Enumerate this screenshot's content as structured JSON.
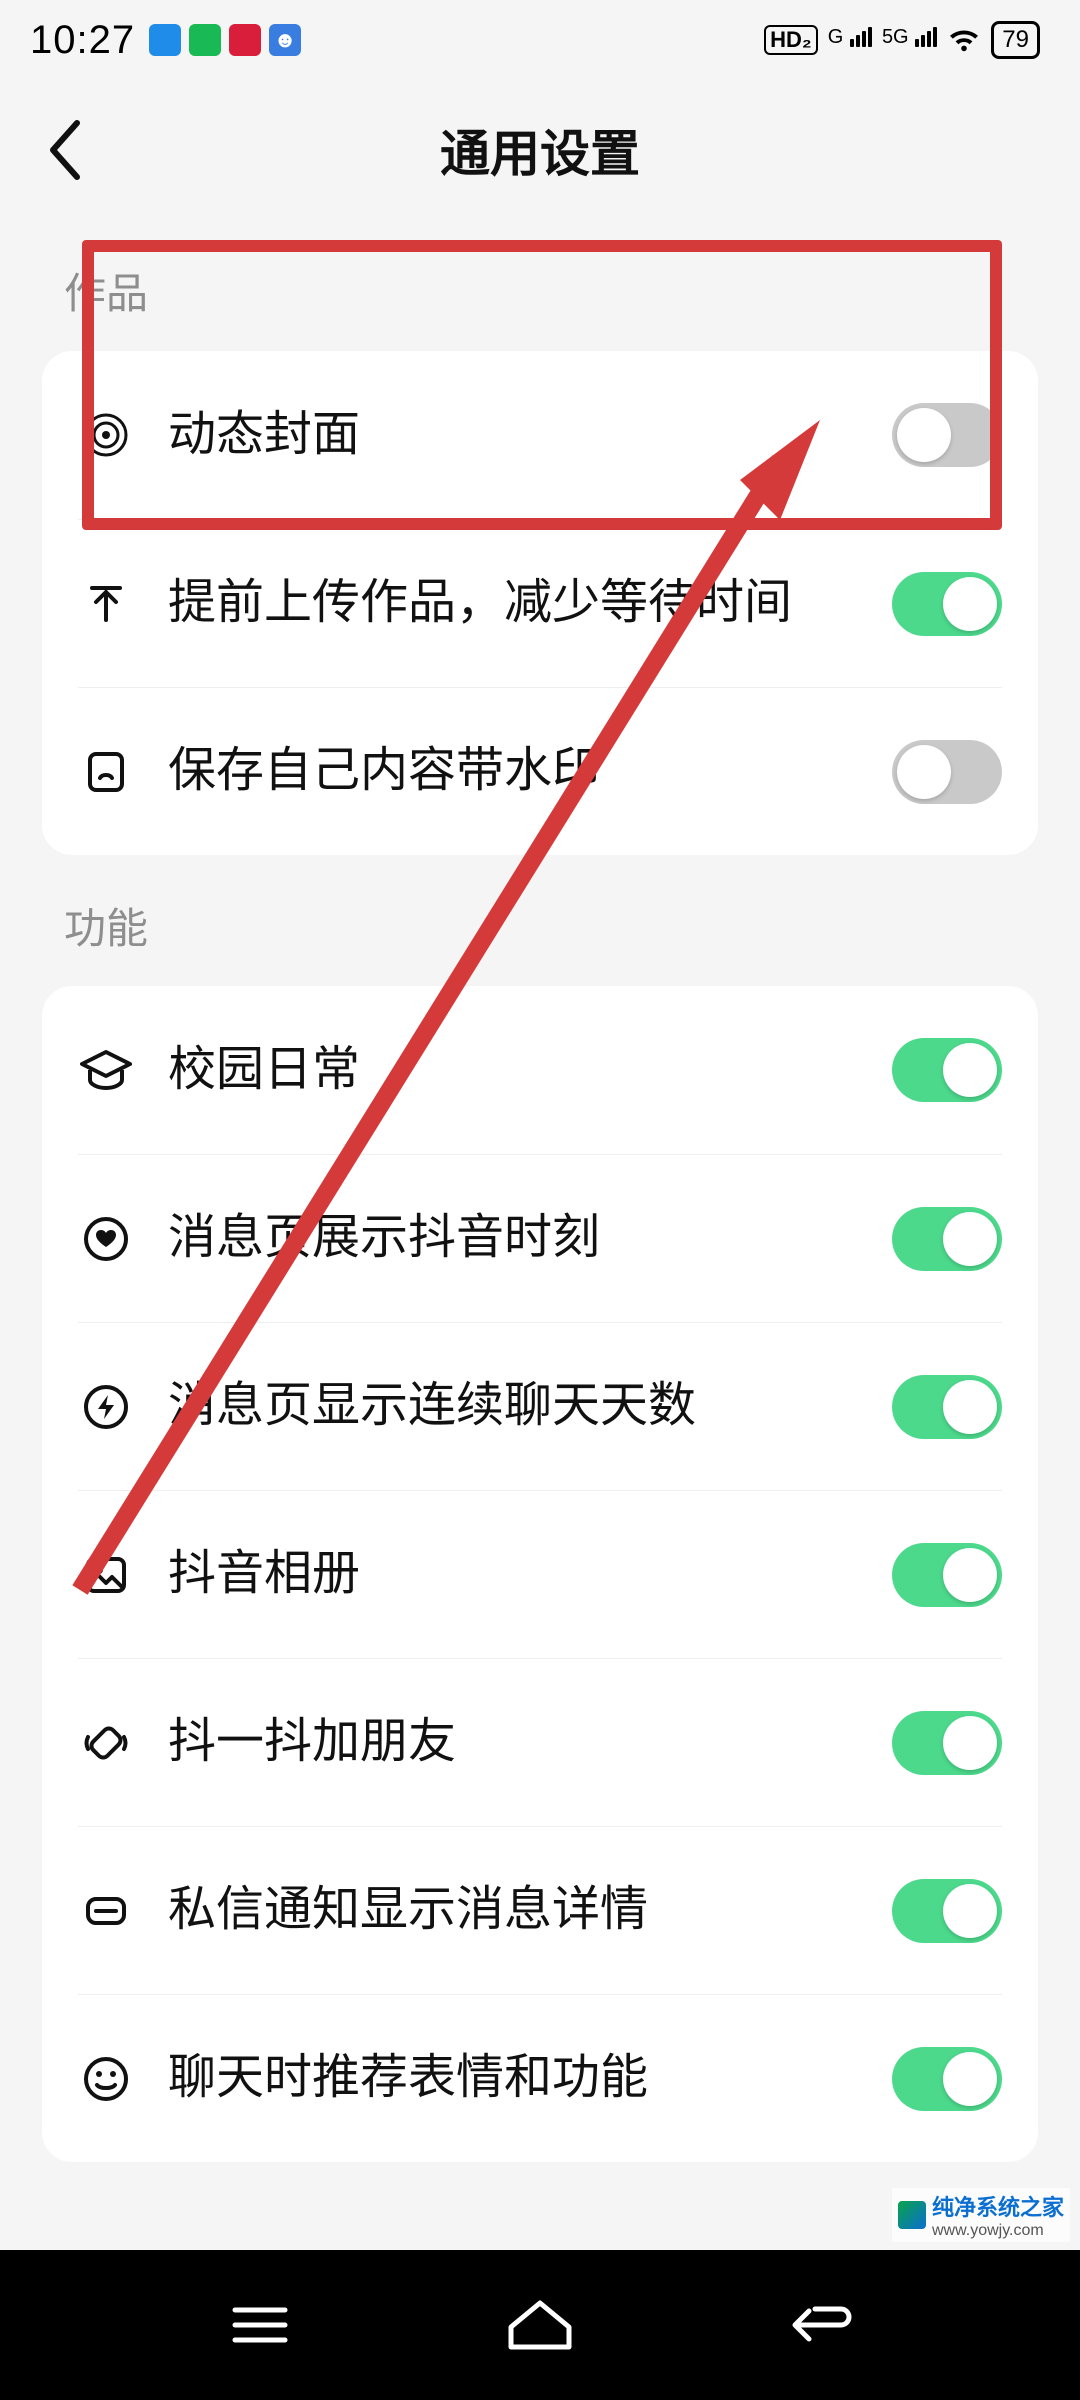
{
  "status": {
    "time": "10:27",
    "hd_label": "HD₂",
    "net1": "G",
    "net2": "5G",
    "battery": "79"
  },
  "header": {
    "title": "通用设置"
  },
  "sections": {
    "works": {
      "label": "作品",
      "items": [
        {
          "icon": "target-icon",
          "label": "动态封面",
          "on": false
        },
        {
          "icon": "upload-icon",
          "label": "提前上传作品，减少等待时间",
          "on": true
        },
        {
          "icon": "page-icon",
          "label": "保存自己内容带水印",
          "on": false
        }
      ]
    },
    "features": {
      "label": "功能",
      "items": [
        {
          "icon": "graduation-cap-icon",
          "label": "校园日常",
          "on": true
        },
        {
          "icon": "heart-circle-icon",
          "label": "消息页展示抖音时刻",
          "on": true
        },
        {
          "icon": "lightning-circle-icon",
          "label": "消息页显示连续聊天天数",
          "on": true
        },
        {
          "icon": "photo-icon",
          "label": "抖音相册",
          "on": true
        },
        {
          "icon": "shake-icon",
          "label": "抖一抖加朋友",
          "on": true
        },
        {
          "icon": "message-detail-icon",
          "label": "私信通知显示消息详情",
          "on": true
        },
        {
          "icon": "smiley-icon",
          "label": "聊天时推荐表情和功能",
          "on": true
        }
      ]
    }
  },
  "watermark": {
    "text": "纯净系统之家",
    "url": "www.yowjy.com"
  },
  "colors": {
    "toggle_on": "#4cd98c",
    "toggle_off": "#c9c9c9",
    "annotation": "#d53a3a"
  }
}
